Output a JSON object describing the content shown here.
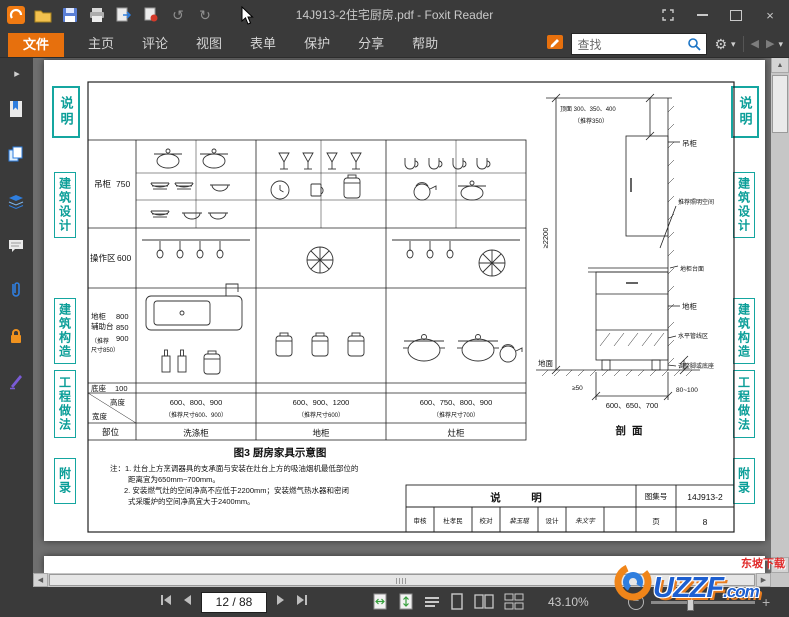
{
  "window": {
    "title": "14J913-2住宅厨房.pdf - Foxit Reader"
  },
  "menu": {
    "file": "文件",
    "items": [
      "主页",
      "评论",
      "视图",
      "表单",
      "保护",
      "分享",
      "帮助"
    ]
  },
  "search": {
    "value": "查找"
  },
  "glyphs": {
    "undo": "↺",
    "redo": "↻",
    "gear": "⚙",
    "caret": "▾",
    "left": "◀",
    "right": "▶",
    "up": "▲",
    "down": "▼",
    "minus": "−",
    "plus": "+",
    "panel": "▸",
    "close": "×"
  },
  "statusbar": {
    "page": "12 / 88",
    "zoom": "43.10%"
  },
  "watermark": {
    "main": "UZZF",
    "dotcom": ".com",
    "sub": "东坡下载"
  },
  "page": {
    "tabs": [
      "说明",
      "建筑设计",
      "建筑构造",
      "工程做法",
      "附录"
    ]
  },
  "diagram": {
    "grid": {
      "r1_label": "吊柜",
      "r1_dim": "750",
      "r2_label": "操作区",
      "r2_dim": "600",
      "r3_label1": "地柜",
      "r3_label2": "辅助台",
      "r3_note1": "（推荐",
      "r3_note2": "尺寸850）",
      "r3_d1": "800",
      "r3_d2": "850",
      "r3_d3": "900",
      "r4_label": "底座",
      "r4_dim": "100",
      "h_label": "高度",
      "w_label": "宽度",
      "part_label": "部位",
      "c1_dims": "600、800、900",
      "c1_note": "（推荐尺寸600、900）",
      "c2_dims": "600、900、1200",
      "c2_note": "（推荐尺寸600）",
      "c3_dims": "600、750、800、900",
      "c3_note": "（推荐尺寸700）",
      "c1_name": "洗涤柜",
      "c2_name": "地柜",
      "c3_name": "灶柜"
    },
    "section": {
      "ceiling": "顶面 300、350、400",
      "ceiling_note": "（推荐350）",
      "height": "≥2200",
      "cab": "吊柜",
      "light": "推荐照明空间",
      "counter": "地柜台面",
      "base": "地柜",
      "pipes": "水平管线区",
      "feet": "调整脚或底座",
      "floor": "地面",
      "clearance": "≥50",
      "foot_h": "80~100",
      "depth": "600、650、700",
      "caption": "剖面"
    },
    "figure_title": "图3 厨房家具示意图",
    "notes": [
      "注：1. 灶台上方烹调器具的支承面与安装在灶台上方的吸油烟机最低部位的",
      "距离宜为650mm~700mm。",
      "2. 安装燃气灶的空间净高不应低于2200mm；安装燃气热水器和密闭",
      "式采暖炉的空间净高宜大于2400mm。"
    ],
    "block": {
      "title": "说　明",
      "atlas_label": "图集号",
      "atlas_no": "14J913-2",
      "c1": "审核",
      "n1": "杜孝民",
      "c2": "校对",
      "n2": "裴玉琨",
      "c3": "设计",
      "n3": "朱文宇",
      "page_label": "页",
      "page_no": "8"
    }
  }
}
